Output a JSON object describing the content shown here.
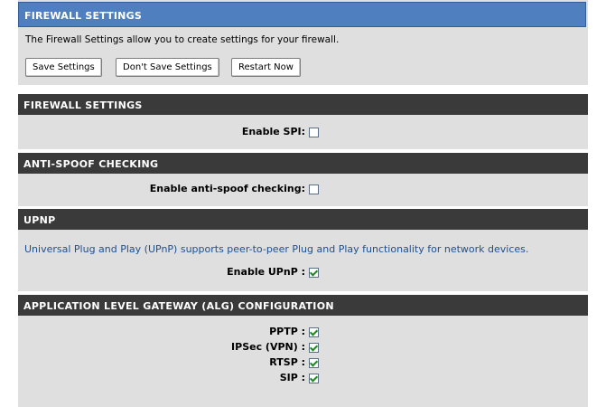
{
  "intro": {
    "title": "FIREWALL SETTINGS",
    "description": "The Firewall Settings allow you to create settings for your firewall.",
    "buttons": {
      "save": "Save Settings",
      "dont_save": "Don't Save Settings",
      "restart": "Restart Now"
    }
  },
  "firewall": {
    "title": "FIREWALL SETTINGS",
    "spi_label": "Enable SPI:",
    "spi_checked": false
  },
  "antispoof": {
    "title": "ANTI-SPOOF CHECKING",
    "label": "Enable anti-spoof checking:",
    "checked": false
  },
  "upnp": {
    "title": "UPNP",
    "description": "Universal Plug and Play (UPnP) supports peer-to-peer Plug and Play functionality for network devices.",
    "label": "Enable UPnP :",
    "checked": true
  },
  "alg": {
    "title": "APPLICATION LEVEL GATEWAY (ALG) CONFIGURATION",
    "items": [
      {
        "label": "PPTP :",
        "checked": true
      },
      {
        "label": "IPSec (VPN) :",
        "checked": true
      },
      {
        "label": "RTSP :",
        "checked": true
      },
      {
        "label": "SIP :",
        "checked": true
      }
    ]
  },
  "colors": {
    "intro_header": "#4f7fbf",
    "section_header": "#3a3a3a",
    "panel_bg": "#dfdfdf",
    "upnp_text": "#1d4f8f",
    "check_mark": "#1f8a1f"
  }
}
